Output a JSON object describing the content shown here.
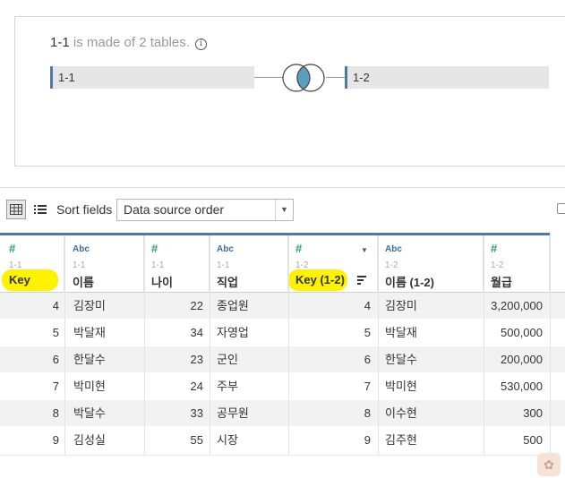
{
  "join": {
    "table_name": "1-1",
    "title_suffix": " is made of 2 tables.",
    "info_icon": "i",
    "left_table": "1-1",
    "right_table": "1-2",
    "join_type_icon": "inner-join-venn-icon"
  },
  "toolbar": {
    "sort_label": "Sort fields",
    "sort_value": "Data source order",
    "caret": "▼"
  },
  "columns": [
    {
      "type": "#",
      "source": "1-1",
      "name": "Key",
      "highlighted": true
    },
    {
      "type": "Abc",
      "source": "1-1",
      "name": "이름"
    },
    {
      "type": "#",
      "source": "1-1",
      "name": "나이"
    },
    {
      "type": "Abc",
      "source": "1-1",
      "name": "직업"
    },
    {
      "type": "#",
      "source": "1-2",
      "name": "Key (1-2)",
      "highlighted": true
    },
    {
      "type": "Abc",
      "source": "1-2",
      "name": "이름 (1-2)"
    },
    {
      "type": "#",
      "source": "1-2",
      "name": "월급"
    }
  ],
  "rows": [
    [
      "4",
      "김장미",
      "22",
      "종업원",
      "4",
      "김장미",
      "3,200,000"
    ],
    [
      "5",
      "박달재",
      "34",
      "자영업",
      "5",
      "박달재",
      "500,000"
    ],
    [
      "6",
      "한달수",
      "23",
      "군인",
      "6",
      "한달수",
      "200,000"
    ],
    [
      "7",
      "박미현",
      "24",
      "주부",
      "7",
      "박미현",
      "530,000"
    ],
    [
      "8",
      "박달수",
      "33",
      "공무원",
      "8",
      "이수현",
      "300"
    ],
    [
      "9",
      "김성실",
      "55",
      "시장",
      "9",
      "김주현",
      "500"
    ]
  ],
  "colors": {
    "accent": "#4e79a7",
    "highlight": "#fff200",
    "venn_fill": "#5b9fc0"
  }
}
